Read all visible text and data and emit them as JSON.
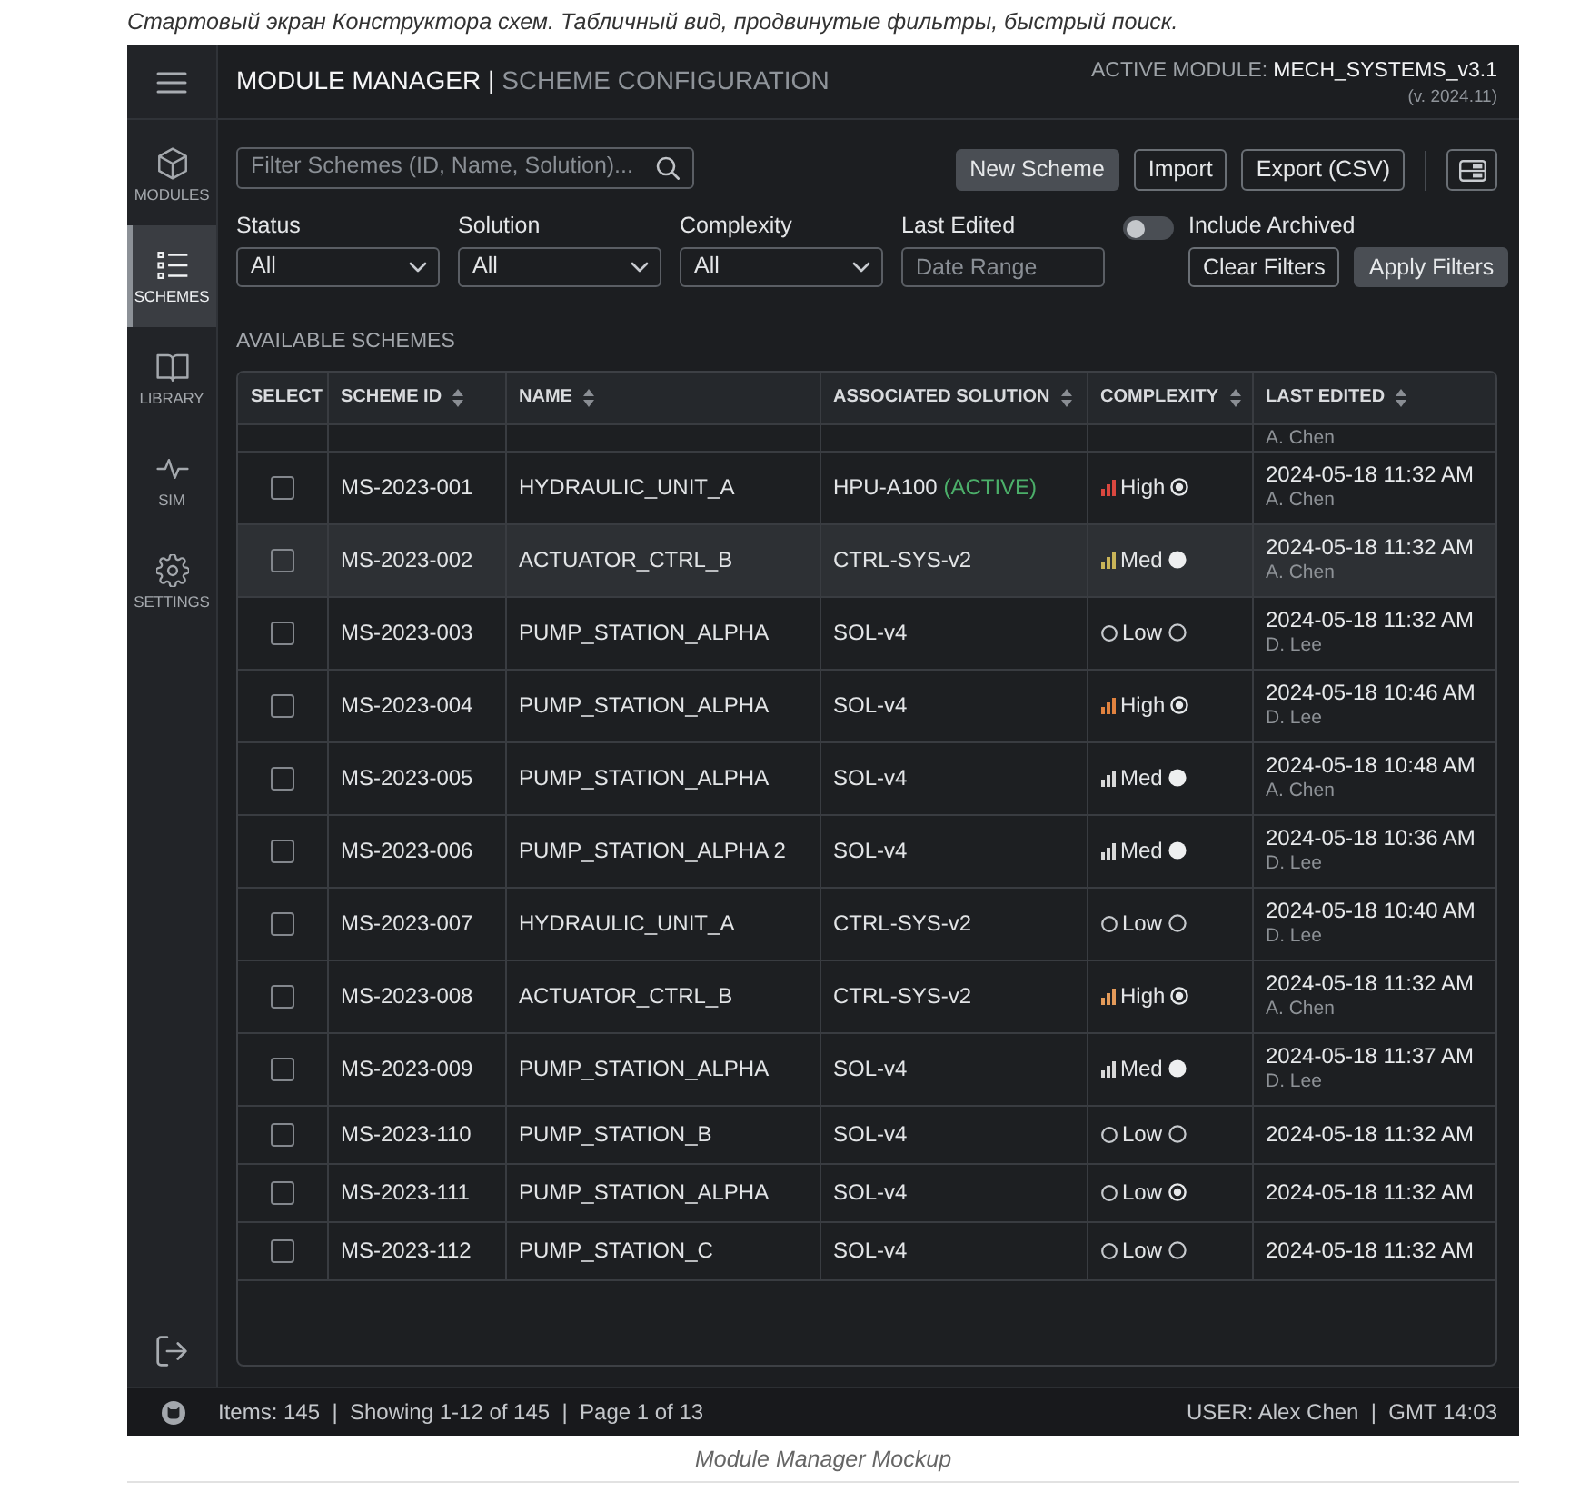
{
  "caption_top": "Стартовый экран Конструктора схем. Табличный вид, продвинутые фильтры, быстрый поиск.",
  "header": {
    "title": "MODULE MANAGER |",
    "subtitle": "SCHEME CONFIGURATION",
    "active_module_label": "ACTIVE MODULE:",
    "active_module": "MECH_SYSTEMS_v3.1",
    "version": "(v. 2024.11)"
  },
  "sidebar": {
    "items": [
      {
        "label": "MODULES",
        "selected": false
      },
      {
        "label": "SCHEMES",
        "selected": true
      },
      {
        "label": "LIBRARY",
        "selected": false
      },
      {
        "label": "SIM",
        "selected": false
      },
      {
        "label": "SETTINGS",
        "selected": false
      }
    ]
  },
  "toolbar": {
    "search": {
      "placeholder": "Filter Schemes (ID, Name, Solution)..."
    },
    "buttons": [
      {
        "label": "New Scheme",
        "kind": "filled"
      },
      {
        "label": "Import",
        "kind": "outline"
      },
      {
        "label": "Export (CSV)",
        "kind": "outline"
      }
    ]
  },
  "filters": {
    "fields": [
      {
        "label": "Status",
        "kind": "select",
        "value": "All"
      },
      {
        "label": "Solution",
        "kind": "select",
        "value": "All"
      },
      {
        "label": "Complexity",
        "kind": "select",
        "value": "All"
      },
      {
        "label": "Last Edited",
        "kind": "text",
        "placeholder": "Date Range"
      }
    ],
    "toggle": {
      "label": "Include Archived",
      "on": false
    },
    "buttons": [
      {
        "label": "Clear Filters",
        "kind": "outline"
      },
      {
        "label": "Apply Filters",
        "kind": "filled"
      }
    ]
  },
  "section_title": "AVAILABLE SCHEMES",
  "table": {
    "columns": [
      {
        "label": "SELECT",
        "sortable": false
      },
      {
        "label": "SCHEME ID",
        "sortable": true
      },
      {
        "label": "NAME",
        "sortable": true
      },
      {
        "label": "ASSOCIATED SOLUTION",
        "sortable": true
      },
      {
        "label": "COMPLEXITY",
        "sortable": true
      },
      {
        "label": "LAST EDITED",
        "sortable": true
      }
    ],
    "partial_row": {
      "edited_by": "A. Chen"
    },
    "rows": [
      {
        "checked": false,
        "selected": false,
        "id": "MS-2023-001",
        "name": "HYDRAULIC_UNIT_A",
        "solution": "HPU-A100",
        "solution_tag": "(ACTIVE)",
        "complexity": {
          "label": "High",
          "kind": "bars",
          "color": "#d9473f"
        },
        "marker": {
          "kind": "target"
        },
        "edited": "2024-05-18 11:32 AM",
        "edited_by": "A. Chen"
      },
      {
        "checked": false,
        "selected": true,
        "id": "MS-2023-002",
        "name": "ACTUATOR_CTRL_B",
        "solution": "CTRL-SYS-v2",
        "complexity": {
          "label": "Med",
          "kind": "bars",
          "color": "#c9b458"
        },
        "marker": {
          "kind": "dot"
        },
        "edited": "2024-05-18 11:32 AM",
        "edited_by": "A. Chen"
      },
      {
        "checked": false,
        "selected": false,
        "id": "MS-2023-003",
        "name": "PUMP_STATION_ALPHA",
        "solution": "SOL-v4",
        "complexity": {
          "label": "Low",
          "kind": "ring"
        },
        "marker": {
          "kind": "ring"
        },
        "edited": "2024-05-18 11:32 AM",
        "edited_by": "D. Lee"
      },
      {
        "checked": false,
        "selected": false,
        "id": "MS-2023-004",
        "name": "PUMP_STATION_ALPHA",
        "solution": "SOL-v4",
        "complexity": {
          "label": "High",
          "kind": "bars",
          "color": "#e0823f"
        },
        "marker": {
          "kind": "target"
        },
        "edited": "2024-05-18 10:46 AM",
        "edited_by": "D. Lee"
      },
      {
        "checked": false,
        "selected": false,
        "id": "MS-2023-005",
        "name": "PUMP_STATION_ALPHA",
        "solution": "SOL-v4",
        "complexity": {
          "label": "Med",
          "kind": "bars",
          "color": "#d8d8d8"
        },
        "marker": {
          "kind": "dot"
        },
        "edited": "2024-05-18 10:48 AM",
        "edited_by": "A. Chen"
      },
      {
        "checked": false,
        "selected": false,
        "id": "MS-2023-006",
        "name": "PUMP_STATION_ALPHA 2",
        "solution": "SOL-v4",
        "complexity": {
          "label": "Med",
          "kind": "bars",
          "color": "#d8d8d8"
        },
        "marker": {
          "kind": "dot"
        },
        "edited": "2024-05-18 10:36 AM",
        "edited_by": "D. Lee"
      },
      {
        "checked": false,
        "selected": false,
        "id": "MS-2023-007",
        "name": "HYDRAULIC_UNIT_A",
        "solution": "CTRL-SYS-v2",
        "complexity": {
          "label": "Low",
          "kind": "ring"
        },
        "marker": {
          "kind": "ring"
        },
        "edited": "2024-05-18 10:40 AM",
        "edited_by": "D. Lee"
      },
      {
        "checked": false,
        "selected": false,
        "id": "MS-2023-008",
        "name": "ACTUATOR_CTRL_B",
        "solution": "CTRL-SYS-v2",
        "complexity": {
          "label": "High",
          "kind": "bars",
          "color": "#e39a5a"
        },
        "marker": {
          "kind": "target"
        },
        "edited": "2024-05-18 11:32 AM",
        "edited_by": "A. Chen"
      },
      {
        "checked": false,
        "selected": false,
        "id": "MS-2023-009",
        "name": "PUMP_STATION_ALPHA",
        "solution": "SOL-v4",
        "complexity": {
          "label": "Med",
          "kind": "bars",
          "color": "#d8d8d8"
        },
        "marker": {
          "kind": "dot"
        },
        "edited": "2024-05-18 11:37 AM",
        "edited_by": "D. Lee"
      },
      {
        "checked": false,
        "selected": false,
        "id": "MS-2023-110",
        "name": "PUMP_STATION_B",
        "solution": "SOL-v4",
        "complexity": {
          "label": "Low",
          "kind": "ring"
        },
        "marker": {
          "kind": "ring"
        },
        "edited": "2024-05-18 11:32 AM"
      },
      {
        "checked": false,
        "selected": false,
        "id": "MS-2023-111",
        "name": "PUMP_STATION_ALPHA",
        "solution": "SOL-v4",
        "complexity": {
          "label": "Low",
          "kind": "ring"
        },
        "marker": {
          "kind": "target"
        },
        "edited": "2024-05-18 11:32 AM"
      },
      {
        "checked": false,
        "selected": false,
        "id": "MS-2023-112",
        "name": "PUMP_STATION_C",
        "solution": "SOL-v4",
        "complexity": {
          "label": "Low",
          "kind": "ring"
        },
        "marker": {
          "kind": "ring"
        },
        "edited": "2024-05-18 11:32 AM"
      }
    ]
  },
  "status_bar": {
    "left": "Items: 145  |  Showing 1-12 of 145  |  Page 1 of 13",
    "right": "USER: Alex Chen  |  GMT 14:03"
  },
  "caption_bottom": "Module Manager Mockup"
}
